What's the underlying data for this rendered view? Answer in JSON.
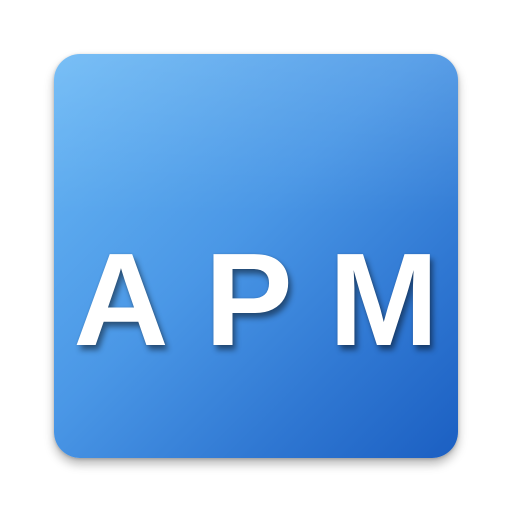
{
  "icon": {
    "letters": [
      "A",
      "P",
      "M"
    ]
  },
  "colors": {
    "gradient_start": "#6ab8f5",
    "gradient_end": "#1b5fc2",
    "text": "#ffffff"
  }
}
